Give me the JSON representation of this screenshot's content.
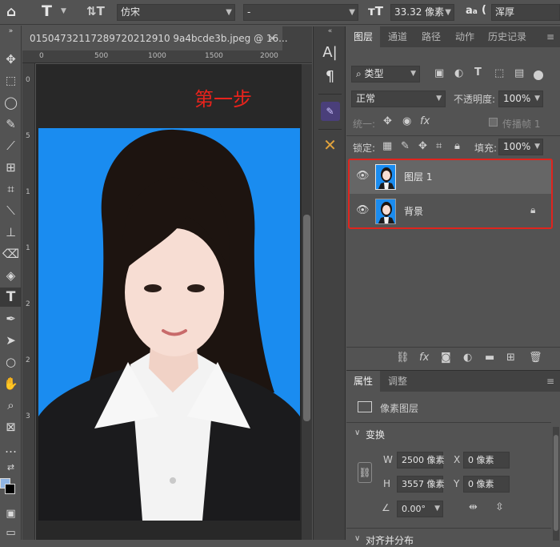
{
  "options_bar": {
    "font_family": "仿宋",
    "font_style": "-",
    "font_size": "33.32 像素",
    "aa_label": "a",
    "aa_sub": "a",
    "antialias": "浑厚"
  },
  "document": {
    "tab_title": "01504732117289720212910 9a4bcde3b.jpeg @ 16...",
    "ruler_h": [
      "0",
      "500",
      "1000",
      "1500",
      "2000"
    ],
    "ruler_v": [
      "0",
      "5",
      "1",
      "1",
      "2",
      "2",
      "3"
    ],
    "step_text": "第一步"
  },
  "layers": {
    "tabs": [
      "图层",
      "通道",
      "路径",
      "动作",
      "历史记录"
    ],
    "filter_kind": "类型",
    "blend_mode": "正常",
    "opacity_label": "不透明度:",
    "opacity_value": "100%",
    "unify_label": "统一:",
    "propagate_label": "传播帧 1",
    "lock_label": "锁定:",
    "fill_label": "填充:",
    "fill_value": "100%",
    "items": [
      {
        "name": "图层 1"
      },
      {
        "name": "背景"
      }
    ]
  },
  "properties": {
    "tabs": [
      "属性",
      "调整"
    ],
    "kind": "像素图层",
    "section_transform": "变换",
    "w_label": "W",
    "w_value": "2500 像素",
    "h_label": "H",
    "h_value": "3557 像素",
    "x_label": "X",
    "x_value": "0 像素",
    "y_label": "Y",
    "y_value": "0 像素",
    "angle_value": "0.00°",
    "section_align": "对齐并分布"
  },
  "colors": {
    "photo_bg": "#1a8cf0",
    "highlight_border": "#e0241d",
    "step_text": "#e8231c"
  }
}
